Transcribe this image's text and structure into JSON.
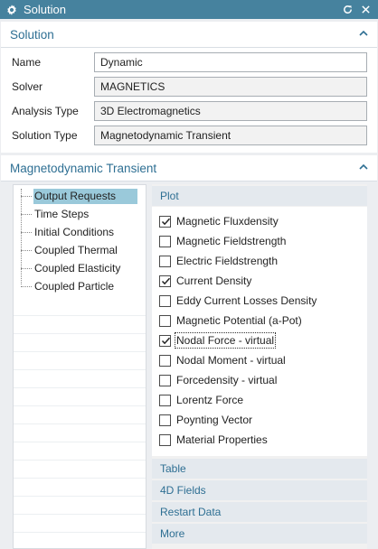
{
  "window": {
    "title": "Solution",
    "icon": "gear-icon",
    "reset_icon": "reset-icon",
    "close_icon": "close-icon"
  },
  "solution": {
    "title": "Solution",
    "fields": [
      {
        "label": "Name",
        "value": "Dynamic",
        "editable": true
      },
      {
        "label": "Solver",
        "value": "MAGNETICS",
        "editable": false
      },
      {
        "label": "Analysis Type",
        "value": "3D Electromagnetics",
        "editable": false
      },
      {
        "label": "Solution Type",
        "value": "Magnetodynamic Transient",
        "editable": false
      }
    ]
  },
  "transient": {
    "title": "Magnetodynamic Transient",
    "tree": [
      {
        "label": "Output Requests",
        "selected": true
      },
      {
        "label": "Time Steps",
        "selected": false
      },
      {
        "label": "Initial Conditions",
        "selected": false
      },
      {
        "label": "Coupled Thermal",
        "selected": false
      },
      {
        "label": "Coupled Elasticity",
        "selected": false
      },
      {
        "label": "Coupled Particle",
        "selected": false
      }
    ],
    "plot": {
      "title": "Plot",
      "options": [
        {
          "label": "Magnetic Fluxdensity",
          "checked": true
        },
        {
          "label": "Magnetic Fieldstrength",
          "checked": false
        },
        {
          "label": "Electric Fieldstrength",
          "checked": false
        },
        {
          "label": "Current Density",
          "checked": true
        },
        {
          "label": "Eddy Current Losses Density",
          "checked": false
        },
        {
          "label": "Magnetic Potential (a-Pot)",
          "checked": false
        },
        {
          "label": "Nodal Force - virtual",
          "checked": true,
          "focused": true
        },
        {
          "label": "Nodal Moment - virtual",
          "checked": false
        },
        {
          "label": "Forcedensity - virtual",
          "checked": false
        },
        {
          "label": "Lorentz Force",
          "checked": false
        },
        {
          "label": "Poynting Vector",
          "checked": false
        },
        {
          "label": "Material Properties",
          "checked": false
        }
      ]
    },
    "groups": [
      "Table",
      "4D Fields",
      "Restart Data",
      "More"
    ]
  },
  "colors": {
    "titlebar": "#46829e",
    "accent": "#2e6f93",
    "selection": "#9ac9da"
  }
}
